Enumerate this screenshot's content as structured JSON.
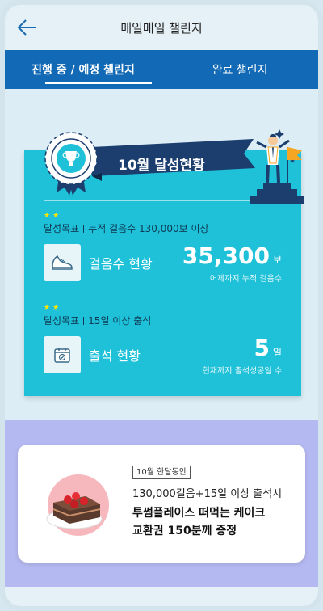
{
  "header": {
    "title": "매일매일 챌린지"
  },
  "tabs": [
    {
      "label": "진행 중 / 예정 챌린지",
      "active": true
    },
    {
      "label": "완료 챌린지",
      "active": false
    }
  ],
  "banner": {
    "title": "10월 달성현황"
  },
  "steps": {
    "goal_prefix": "달성목표",
    "goal_text": "누적 걸음수 130,000보 이상",
    "label": "걸음수 현황",
    "value": "35,300",
    "unit": "보",
    "sub": "어제까지 누적 걸음수",
    "stars": "★★"
  },
  "attendance": {
    "goal_prefix": "달성목표",
    "goal_text": "15일 이상 출석",
    "label": "출석 현황",
    "value": "5",
    "unit": "일",
    "sub": "현재까지 출석성공일 수",
    "stars": "★★"
  },
  "prize": {
    "tag": "10월 한달동안",
    "condition": "130,000걸음+15일 이상 출석시",
    "reward_line1": "투썸플레이스 떠먹는 케이크",
    "reward_line2": "교환권 150분께 증정"
  },
  "colors": {
    "tab_bar": "#1269b5",
    "card": "#1fc1d8",
    "banner": "#1b3e6e",
    "bottom": "#b5b9f1"
  }
}
